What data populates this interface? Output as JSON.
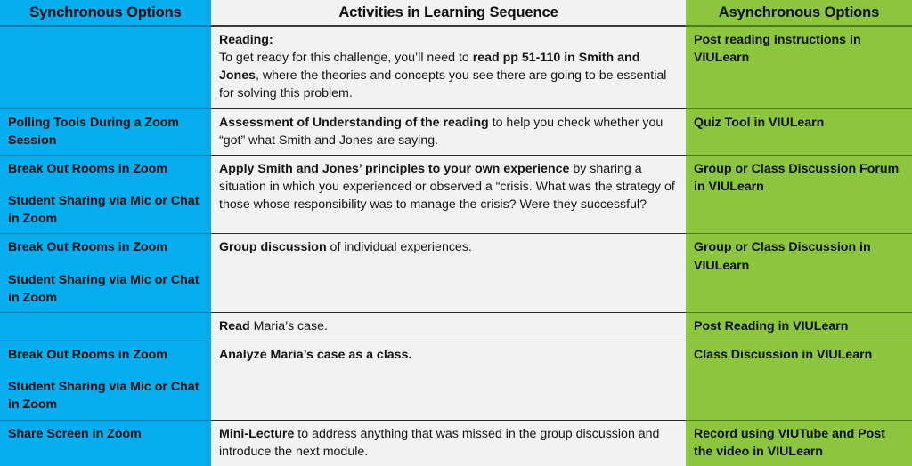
{
  "colors": {
    "synchronous_header_bg": "#06aeef",
    "activities_header_bg": "#f2f2f2",
    "asynchronous_header_bg": "#8cc63e",
    "activities_cell_bg": "#f2f2f2",
    "text": "#111111"
  },
  "table": {
    "headers": {
      "synchronous": "Synchronous Options",
      "activities": "Activities in Learning Sequence",
      "asynchronous": "Asynchronous Options"
    },
    "rows": [
      {
        "synchronous": "",
        "synchronous_line2": "",
        "activity_bold_lead": "Reading:",
        "activity_body_pre": "To get ready for this challenge, you’ll need to ",
        "activity_body_bold": "read pp 51-110 in Smith and Jones",
        "activity_body_post": ", where the theories and concepts you see there are going to be essential for solving this problem.",
        "asynchronous": "Post reading instructions in VIULearn"
      },
      {
        "synchronous": "Polling Tools During a Zoom Session",
        "synchronous_line2": "",
        "activity_bold_lead": "",
        "activity_body_pre": "",
        "activity_body_bold": "Assessment of Understanding of the reading",
        "activity_body_post": " to help you check whether you “got” what Smith and Jones are saying.",
        "asynchronous": "Quiz Tool in VIULearn"
      },
      {
        "synchronous": "Break Out Rooms in Zoom",
        "synchronous_line2": "Student Sharing via Mic or Chat in Zoom",
        "activity_bold_lead": "",
        "activity_body_pre": "",
        "activity_body_bold": "Apply Smith and Jones’ principles to your own experience",
        "activity_body_post": " by sharing a situation in which you experienced or observed a “crisis. What was the strategy of those whose responsibility was to manage the crisis? Were they successful?",
        "asynchronous": "Group or Class Discussion Forum in VIULearn"
      },
      {
        "synchronous": "Break Out Rooms in Zoom",
        "synchronous_line2": "Student Sharing via Mic or Chat in Zoom",
        "activity_bold_lead": "",
        "activity_body_pre": "",
        "activity_body_bold": "Group discussion",
        "activity_body_post": " of individual experiences.",
        "asynchronous": "Group or Class Discussion in VIULearn"
      },
      {
        "synchronous": "",
        "synchronous_line2": "",
        "activity_bold_lead": "",
        "activity_body_pre": "",
        "activity_body_bold": "Read",
        "activity_body_post": " Maria’s case.",
        "asynchronous": "Post Reading in VIULearn"
      },
      {
        "synchronous": "Break Out Rooms in Zoom",
        "synchronous_line2": "Student Sharing via Mic or Chat in Zoom",
        "activity_bold_lead": "",
        "activity_body_pre": "",
        "activity_body_bold": "Analyze Maria’s case as a class.",
        "activity_body_post": "",
        "asynchronous": "Class Discussion in VIULearn"
      },
      {
        "synchronous": "Share Screen in Zoom",
        "synchronous_line2": "",
        "activity_bold_lead": "",
        "activity_body_pre": "",
        "activity_body_bold": "Mini-Lecture",
        "activity_body_post": " to address anything that was missed in the group discussion and introduce the next module.",
        "asynchronous": "Record using VIUTube and Post the video in VIULearn"
      }
    ]
  }
}
